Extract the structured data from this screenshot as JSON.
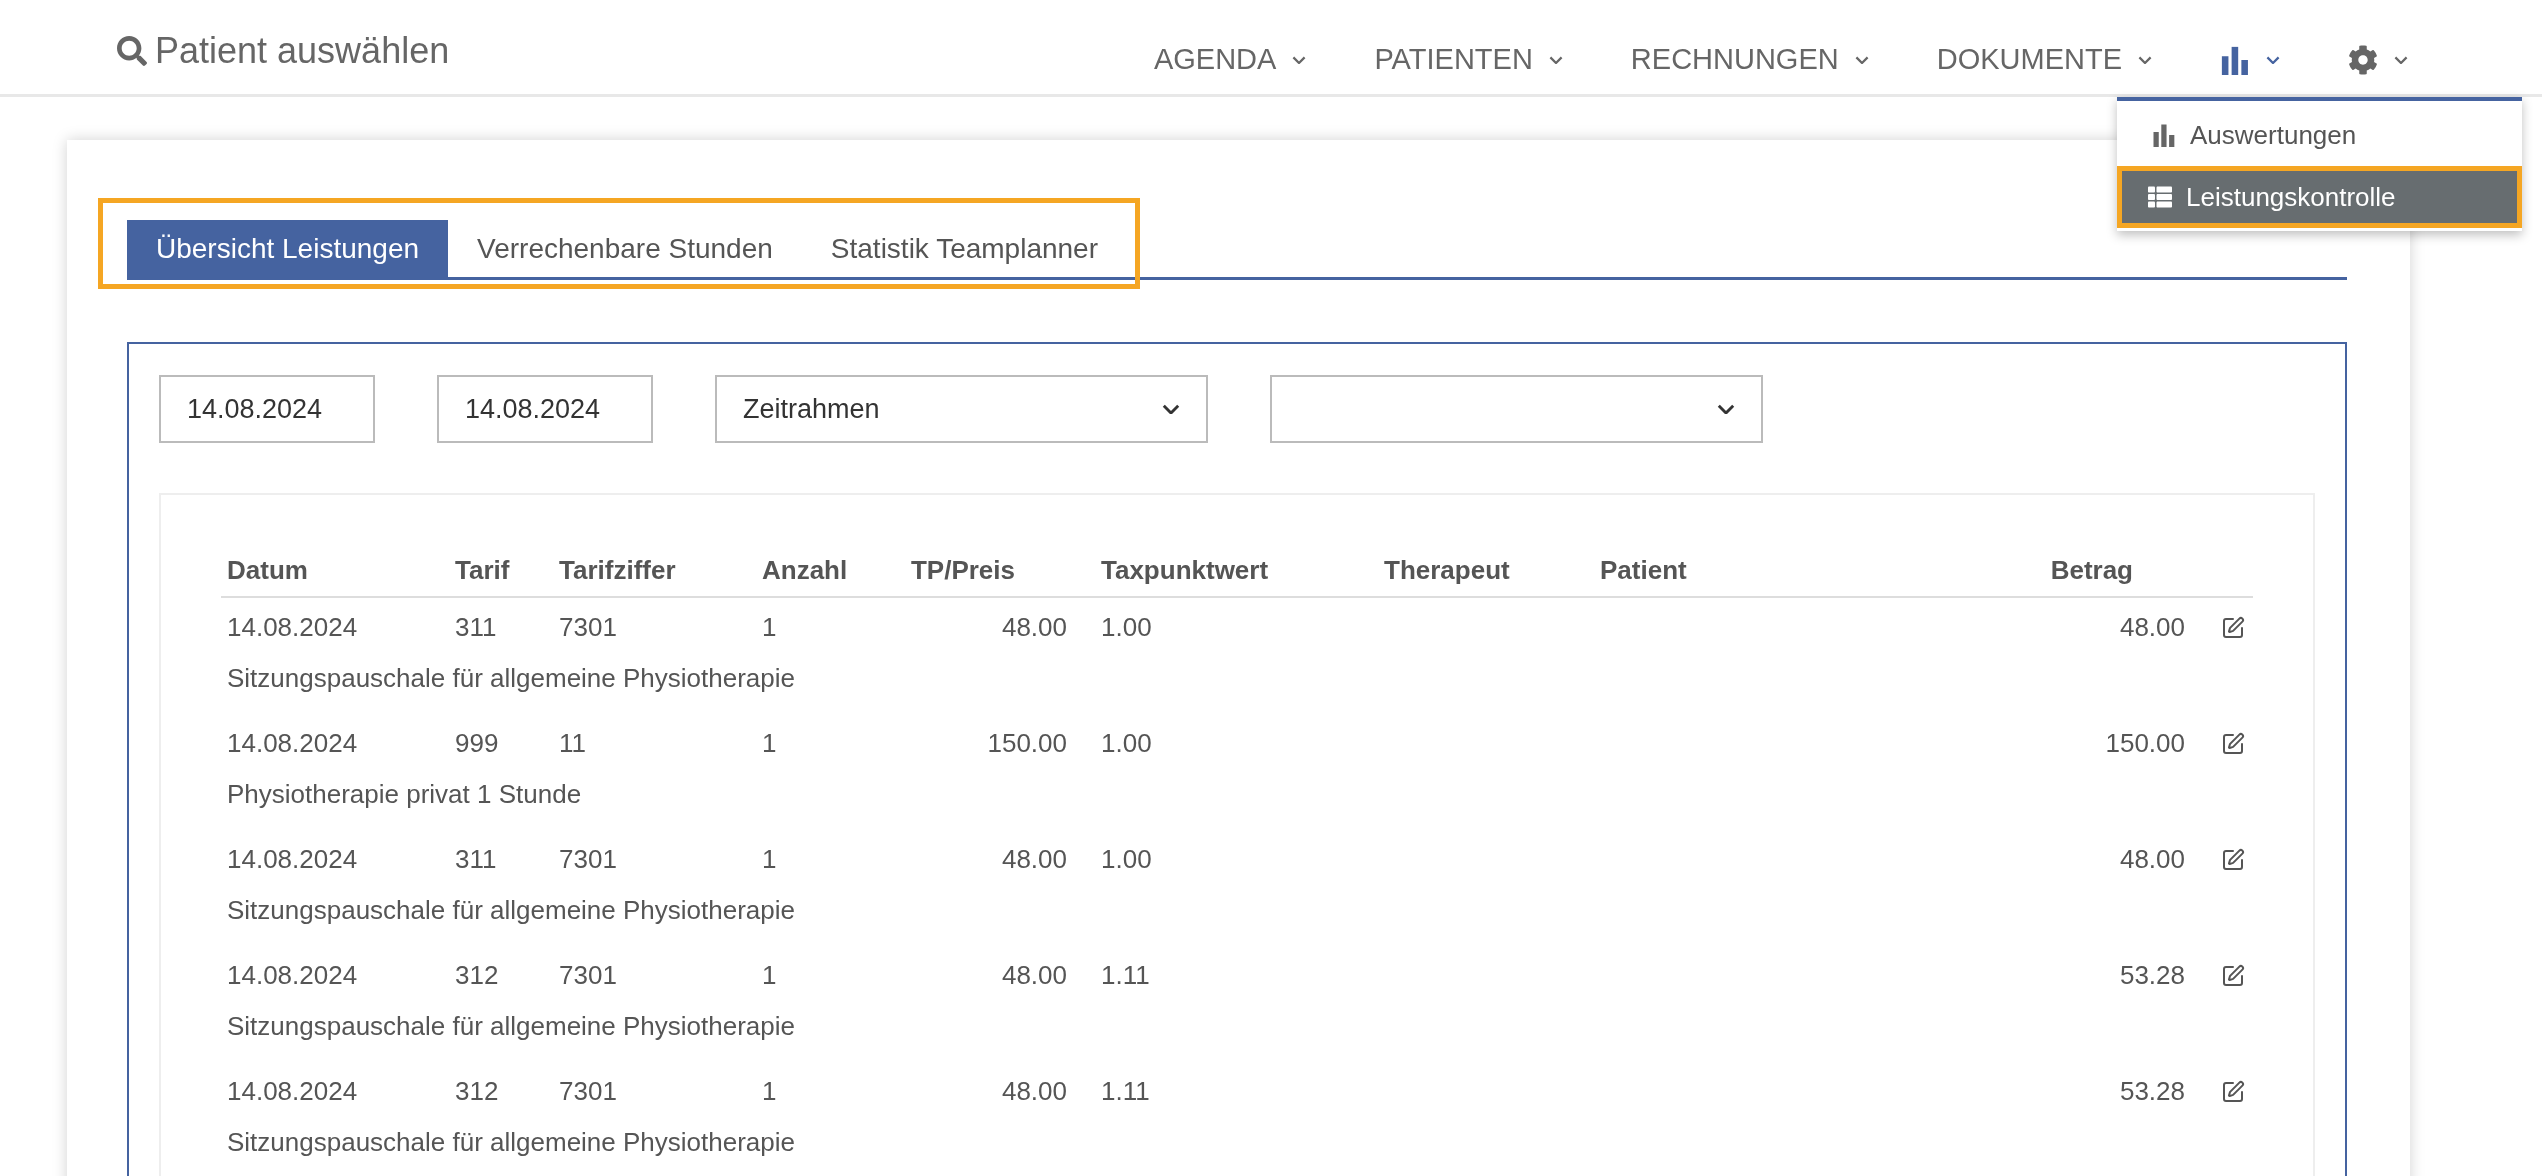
{
  "header": {
    "search_label": "Patient auswählen"
  },
  "nav": [
    {
      "kind": "text",
      "label": "AGENDA",
      "expanded": false
    },
    {
      "kind": "text",
      "label": "PATIENTEN",
      "expanded": false
    },
    {
      "kind": "text",
      "label": "RECHNUNGEN",
      "expanded": false
    },
    {
      "kind": "text",
      "label": "DOKUMENTE",
      "expanded": false
    },
    {
      "kind": "chart",
      "expanded": true
    },
    {
      "kind": "settings",
      "expanded": false
    }
  ],
  "dropdown": [
    {
      "kind": "chart",
      "label": "Auswertungen",
      "selected": false,
      "highlighted": false
    },
    {
      "kind": "table",
      "label": "Leistungskontrolle",
      "selected": true,
      "highlighted": true
    }
  ],
  "tabs_highlighted": true,
  "tabs": [
    {
      "label": "Übersicht Leistungen",
      "selected": true
    },
    {
      "label": "Verrechenbare Stunden",
      "selected": false
    },
    {
      "label": "Statistik Teamplanner",
      "selected": false
    }
  ],
  "filters": {
    "date_from": "14.08.2024",
    "date_to": "14.08.2024",
    "range": "Zeitrahmen"
  },
  "table": {
    "columns": [
      {
        "label": "Datum",
        "kind": "text"
      },
      {
        "label": "Tarif",
        "kind": "text"
      },
      {
        "label": "Tarifziffer",
        "kind": "text"
      },
      {
        "label": "Anzahl",
        "kind": "text"
      },
      {
        "label": "TP/Preis",
        "kind": "number"
      },
      {
        "label": "Taxpunktwert",
        "kind": "text"
      },
      {
        "label": "Therapeut",
        "kind": "text"
      },
      {
        "label": "Patient",
        "kind": "text"
      },
      {
        "label": "Betrag",
        "kind": "number"
      }
    ],
    "rows": [
      {
        "cells": [
          "14.08.2024",
          "311",
          "7301",
          "1",
          "48.00",
          "1.00",
          null,
          null,
          "48.00"
        ],
        "description": "Sitzungspauschale für allgemeine Physiotherapie"
      },
      {
        "cells": [
          "14.08.2024",
          "999",
          "11",
          "1",
          "150.00",
          "1.00",
          null,
          null,
          "150.00"
        ],
        "description": "Physiotherapie privat 1 Stunde"
      },
      {
        "cells": [
          "14.08.2024",
          "311",
          "7301",
          "1",
          "48.00",
          "1.00",
          null,
          null,
          "48.00"
        ],
        "description": "Sitzungspauschale für allgemeine Physiotherapie"
      },
      {
        "cells": [
          "14.08.2024",
          "312",
          "7301",
          "1",
          "48.00",
          "1.11",
          null,
          null,
          "53.28"
        ],
        "description": "Sitzungspauschale für allgemeine Physiotherapie"
      },
      {
        "cells": [
          "14.08.2024",
          "312",
          "7301",
          "1",
          "48.00",
          "1.11",
          null,
          null,
          "53.28"
        ],
        "description": "Sitzungspauschale für allgemeine Physiotherapie"
      }
    ]
  }
}
